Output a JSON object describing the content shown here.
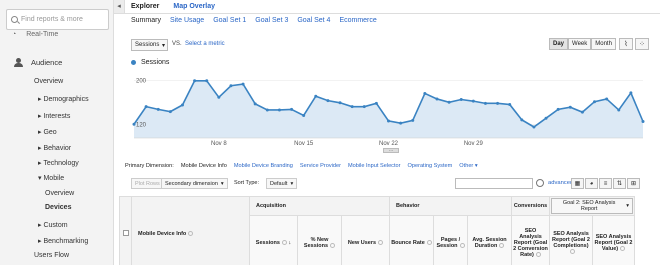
{
  "sidebar": {
    "search_placeholder": "Find reports & more",
    "realtime_label": "Real-Time",
    "audience_label": "Audience",
    "items": [
      {
        "label": "Overview",
        "arrow": ""
      },
      {
        "label": "Demographics",
        "arrow": "▸"
      },
      {
        "label": "Interests",
        "arrow": "▸"
      },
      {
        "label": "Geo",
        "arrow": "▸"
      },
      {
        "label": "Behavior",
        "arrow": "▸"
      },
      {
        "label": "Technology",
        "arrow": "▸"
      },
      {
        "label": "Mobile",
        "arrow": "▾"
      },
      {
        "label": "Overview",
        "arrow": ""
      },
      {
        "label": "Devices",
        "arrow": ""
      },
      {
        "label": "Custom",
        "arrow": "▸"
      },
      {
        "label": "Benchmarking",
        "arrow": "▸"
      },
      {
        "label": "Users Flow",
        "arrow": ""
      }
    ]
  },
  "collapse_icon": "◂",
  "topbar": {
    "explorer": "Explorer",
    "map_overlay": "Map Overlay"
  },
  "tabs": [
    "Summary",
    "Site Usage",
    "Goal Set 1",
    "Goal Set 3",
    "Goal Set 4",
    "Ecommerce"
  ],
  "metric": {
    "selected": "Sessions",
    "vs": "VS.",
    "select_metric": "Select a metric"
  },
  "period": [
    "Day",
    "Week",
    "Month"
  ],
  "chart_icons": [
    "line-chart-icon",
    "scatter-icon"
  ],
  "colors": {
    "accent": "#3a83c2",
    "fill": "#dce9f5",
    "link": "#2a66c6"
  },
  "chart_data": {
    "type": "area",
    "series": [
      {
        "name": "Sessions",
        "values": [
          120,
          152,
          147,
          143,
          155,
          199,
          199,
          169,
          190,
          193,
          157,
          146,
          146,
          147,
          136,
          171,
          163,
          159,
          152,
          152,
          158,
          126,
          122,
          127,
          176,
          166,
          160,
          165,
          162,
          158,
          158,
          156,
          128,
          115,
          131,
          147,
          151,
          142,
          161,
          166,
          146,
          177,
          125
        ]
      }
    ],
    "y_ticks": [
      {
        "label": "200",
        "value": 200
      },
      {
        "label": "120",
        "value": 120
      }
    ],
    "x_ticks": [
      {
        "label": "Nov 8",
        "index": 7
      },
      {
        "label": "Nov 15",
        "index": 14
      },
      {
        "label": "Nov 22",
        "index": 21
      },
      {
        "label": "Nov 29",
        "index": 28
      }
    ],
    "ylim": [
      95,
      215
    ]
  },
  "primary_dim": {
    "label": "Primary Dimension:",
    "current": "Mobile Device Info",
    "options": [
      "Mobile Device Branding",
      "Service Provider",
      "Mobile Input Selector",
      "Operating System",
      "Other ▾"
    ]
  },
  "toolbar": {
    "plot_rows": "Plot Rows",
    "secondary_dimension": "Secondary dimension",
    "sort_type": "Sort Type:",
    "sort_default": "Default",
    "advanced": "advanced"
  },
  "table": {
    "dimension_header": "Mobile Device Info",
    "groups": {
      "acquisition": "Acquisition",
      "behavior": "Behavior",
      "conversions": "Conversions",
      "goal_select": "Goal 2: SEO Analysis Report"
    },
    "columns": [
      "Sessions",
      "% New Sessions",
      "New Users",
      "Bounce Rate",
      "Pages / Session",
      "Avg. Session Duration",
      "SEO Analysis Report (Goal 2 Conversion Rate)",
      "SEO Analysis Report (Goal 2 Completions)",
      "SEO Analysis Report (Goal 2 Value)"
    ]
  }
}
